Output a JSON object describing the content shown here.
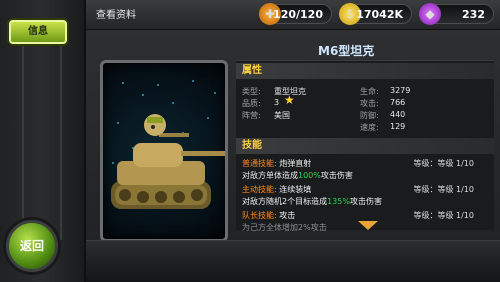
{
  "header": {
    "title": "查看资料",
    "resources": [
      {
        "icon": "food-icon",
        "value": "120/120"
      },
      {
        "icon": "coin-icon",
        "value": "17042K"
      },
      {
        "icon": "gem-icon",
        "value": "232"
      }
    ]
  },
  "sidebar": {
    "info_label": "信息",
    "back_label": "返回"
  },
  "unit": {
    "name": "M6型坦克",
    "attributes_title": "属性",
    "type_label": "类型:",
    "type_value": "重型坦克",
    "quality_label": "品质:",
    "quality_value": "3",
    "faction_label": "阵营:",
    "faction_value": "美国",
    "hp_label": "生命:",
    "hp_value": "3279",
    "atk_label": "攻击:",
    "atk_value": "766",
    "def_label": "防御:",
    "def_value": "440",
    "spd_label": "速度:",
    "spd_value": "129"
  },
  "skills": {
    "title": "技能",
    "items": [
      {
        "type": "普通技能:",
        "name": "炮弹直射",
        "level": "等级：等级 1/10",
        "desc_a": "对敌方单体造成",
        "desc_pct": "100%",
        "desc_b": "攻击伤害"
      },
      {
        "type": "主动技能:",
        "name": "连续装填",
        "level": "等级：等级 1/10",
        "desc_a": "对敌方随机2个目标造成",
        "desc_pct": "135%",
        "desc_b": "攻击伤害"
      },
      {
        "type": "队长技能:",
        "name": "攻击",
        "level": "等级：等级 1/10",
        "desc_a": "为己方全体增加2%攻击",
        "desc_pct": "",
        "desc_b": ""
      }
    ]
  },
  "colors": {
    "accent": "#ffd23a",
    "skill_type": "#ff8a1a",
    "percent": "#27d84a"
  }
}
